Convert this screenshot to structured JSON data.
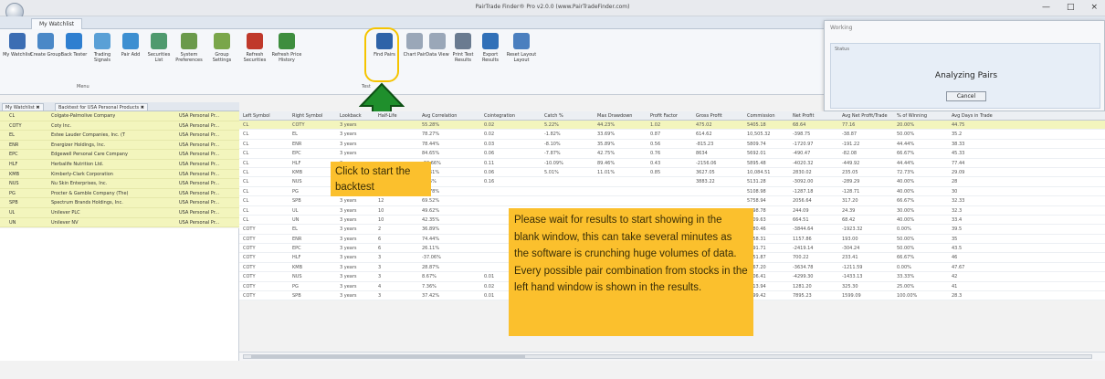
{
  "window": {
    "title": "PairTrade Finder® Pro v2.0.0 (www.PairTradeFinder.com)",
    "controls": [
      "—",
      "□",
      "×"
    ]
  },
  "ribbon": {
    "tab": "My Watchlist",
    "buttons": [
      {
        "label": "My Watchlist",
        "icon": "watchlist-icon",
        "color": "#3b6db3"
      },
      {
        "label": "Create Group",
        "icon": "create-group-icon",
        "color": "#4a88c7"
      },
      {
        "label": "Back Tester",
        "icon": "back-tester-icon",
        "color": "#2f7fd0"
      },
      {
        "label": "Trading Signals",
        "icon": "trading-signals-icon",
        "color": "#5aa0d6"
      },
      {
        "label": "Pair Add",
        "icon": "pair-add-icon",
        "color": "#3d8fd1"
      },
      {
        "label": "Securities List",
        "icon": "securities-list-icon",
        "color": "#4f9a6e"
      },
      {
        "label": "System Preferences",
        "icon": "system-preferences-icon",
        "color": "#6b9a4b"
      },
      {
        "label": "Group Settings",
        "icon": "group-settings-icon",
        "color": "#7aa64a"
      },
      {
        "label": "Refresh Securities",
        "icon": "refresh-securities-icon",
        "color": "#c0392b"
      },
      {
        "label": "Refresh Price History",
        "icon": "refresh-price-history-icon",
        "color": "#3e8e3e"
      },
      {
        "label": "Find Pairs",
        "icon": "find-pairs-icon",
        "color": "#2e63a8"
      },
      {
        "label": "Chart Pair",
        "icon": "chart-pair-icon",
        "color": "#9aa7b8"
      },
      {
        "label": "Data View",
        "icon": "data-view-icon",
        "color": "#9aa7b8"
      },
      {
        "label": "Print Test Results",
        "icon": "print-test-results-icon",
        "color": "#6a7b90"
      },
      {
        "label": "Export Results",
        "icon": "export-results-icon",
        "color": "#3070b8"
      },
      {
        "label": "Reset Layout Layout",
        "icon": "reset-layout-icon",
        "color": "#4a7fbf"
      }
    ],
    "group_menu": "Menu",
    "group_test": "Test"
  },
  "dialog": {
    "title": "Working",
    "status_label": "Status",
    "status_text": "Analyzing Pairs",
    "cancel": "Cancel"
  },
  "left_panel": {
    "tabs": [
      "My Watchlist",
      "Backtest for USA Personal Products"
    ],
    "rows": [
      {
        "symbol": "CL",
        "name": "Colgate-Palmolive Company",
        "group": "USA Personal Pr..."
      },
      {
        "symbol": "COTY",
        "name": "Coty Inc.",
        "group": "USA Personal Pr..."
      },
      {
        "symbol": "EL",
        "name": "Estee Lauder Companies, Inc. (T",
        "group": "USA Personal Pr..."
      },
      {
        "symbol": "ENR",
        "name": "Energizer Holdings, Inc.",
        "group": "USA Personal Pr..."
      },
      {
        "symbol": "EPC",
        "name": "Edgewell Personal Care Company",
        "group": "USA Personal Pr..."
      },
      {
        "symbol": "HLF",
        "name": "Herbalife Nutrition Ltd.",
        "group": "USA Personal Pr..."
      },
      {
        "symbol": "KMB",
        "name": "Kimberly-Clark Corporation",
        "group": "USA Personal Pr..."
      },
      {
        "symbol": "NUS",
        "name": "Nu Skin Enterprises, Inc.",
        "group": "USA Personal Pr..."
      },
      {
        "symbol": "PG",
        "name": "Procter & Gamble Company (The)",
        "group": "USA Personal Pr..."
      },
      {
        "symbol": "SPB",
        "name": "Spectrum Brands Holdings, Inc.",
        "group": "USA Personal Pr..."
      },
      {
        "symbol": "UL",
        "name": "Unilever PLC",
        "group": "USA Personal Pr..."
      },
      {
        "symbol": "UN",
        "name": "Unilever NV",
        "group": "USA Personal Pr..."
      }
    ]
  },
  "grid": {
    "headers": [
      "Left Symbol",
      "Right Symbol",
      "Lookback",
      "Half-Life",
      "Avg Correlation",
      "Cointegration",
      "Catch %",
      "Max Drawdown",
      "Profit Factor",
      "Gross Profit",
      "Commission",
      "Net Profit",
      "Avg Net Profit/Trade",
      "% of Winning",
      "Avg Days in Trade"
    ],
    "rows": [
      [
        "CL",
        "COTY",
        "3 years",
        "",
        "55.28%",
        "0.02",
        "5.22%",
        "44.23%",
        "1.02",
        "475.02",
        "5405.18",
        "68.64",
        "77.16",
        "20.00%",
        "44.75"
      ],
      [
        "CL",
        "EL",
        "3 years",
        "",
        "78.27%",
        "0.02",
        "-1.82%",
        "33.69%",
        "0.87",
        "614.62",
        "10,505.32",
        "-398.75",
        "-38.87",
        "50.00%",
        "35.2"
      ],
      [
        "CL",
        "ENR",
        "3 years",
        "",
        "78.44%",
        "0.03",
        "-8.10%",
        "35.89%",
        "0.56",
        "-815.23",
        "5809.74",
        "-1720.97",
        "-191.22",
        "44.44%",
        "38.33"
      ],
      [
        "CL",
        "EPC",
        "3 years",
        "",
        "84.65%",
        "0.06",
        "-7.87%",
        "42.75%",
        "0.76",
        "8634",
        "5692.01",
        "-490.47",
        "-82.08",
        "66.67%",
        "45.33"
      ],
      [
        "CL",
        "HLF",
        "3 years",
        "",
        "-20.66%",
        "0.11",
        "-10.09%",
        "89.46%",
        "0.43",
        "-2156.06",
        "5895.48",
        "-4020.32",
        "-449.92",
        "44.44%",
        "77.44"
      ],
      [
        "CL",
        "KMB",
        "3 years",
        "",
        "87.61%",
        "0.06",
        "5.01%",
        "11.01%",
        "0.85",
        "3627.05",
        "10,084.51",
        "2830.02",
        "235.05",
        "72.73%",
        "29.09"
      ],
      [
        "CL",
        "NUS",
        "3 years",
        "10",
        "5.55%",
        "0.16",
        "",
        "",
        "",
        "3883.22",
        "5131.28",
        "-3092.00",
        "-289.29",
        "40.00%",
        "28"
      ],
      [
        "CL",
        "PG",
        "3 years",
        "10",
        "56.78%",
        "",
        "",
        "",
        "",
        "",
        "5108.98",
        "-1287.18",
        "-128.71",
        "40.00%",
        "30"
      ],
      [
        "CL",
        "SPB",
        "3 years",
        "12",
        "69.52%",
        "",
        "",
        "",
        "",
        "",
        "5758.94",
        "2056.64",
        "317.20",
        "66.67%",
        "32.33"
      ],
      [
        "CL",
        "UL",
        "3 years",
        "10",
        "49.62%",
        "",
        "",
        "",
        "",
        "",
        "2998.78",
        "244.09",
        "24.39",
        "30.00%",
        "32.3"
      ],
      [
        "CL",
        "UN",
        "3 years",
        "10",
        "42.35%",
        "",
        "",
        "",
        "",
        "",
        "5109.63",
        "664.51",
        "68.42",
        "40.00%",
        "33.4"
      ],
      [
        "COTY",
        "EL",
        "3 years",
        "2",
        "36.89%",
        "",
        "",
        "",
        "",
        "",
        "5780.46",
        "-3844.64",
        "-1923.32",
        "0.00%",
        "39.5"
      ],
      [
        "COTY",
        "ENR",
        "3 years",
        "6",
        "74.44%",
        "",
        "",
        "",
        "",
        "",
        "3958.31",
        "1157.86",
        "193.00",
        "50.00%",
        "35"
      ],
      [
        "COTY",
        "EPC",
        "3 years",
        "6",
        "26.11%",
        "",
        "",
        "",
        "",
        "",
        "5391.71",
        "-2419.14",
        "-304.24",
        "50.00%",
        "43.5"
      ],
      [
        "COTY",
        "HLF",
        "3 years",
        "3",
        "-37.06%",
        "",
        "",
        "",
        "",
        "",
        "3351.87",
        "700.22",
        "233.41",
        "66.67%",
        "46"
      ],
      [
        "COTY",
        "KMB",
        "3 years",
        "3",
        "28.87%",
        "",
        "",
        "",
        "",
        "",
        "5267.20",
        "-3634.78",
        "-1211.59",
        "0.00%",
        "47.67"
      ],
      [
        "COTY",
        "NUS",
        "3 years",
        "3",
        "8.67%",
        "0.01",
        "-11.08%",
        "49.44%",
        "0.66",
        "-4612.89",
        "5306.41",
        "-4299.30",
        "-1433.13",
        "33.33%",
        "42"
      ],
      [
        "COTY",
        "PG",
        "3 years",
        "4",
        "7.36%",
        "0.02",
        "-6.19%",
        "34.60%",
        "1.24",
        "1899.85",
        "3413.94",
        "1281.20",
        "325.30",
        "25.00%",
        "41"
      ],
      [
        "COTY",
        "SPB",
        "3 years",
        "3",
        "37.42%",
        "0.01",
        "21.65%",
        "13.07%",
        "0.65",
        "8484.65",
        "5499.42",
        "7895.23",
        "1599.09",
        "100.00%",
        "28.3"
      ]
    ]
  },
  "callouts": {
    "backtest": "Click to start the backtest",
    "wait": "Please wait for results to start showing in the blank window, this can take several minutes as the software is crunching huge volumes of data. Every possible pair combination from stocks in the left hand window is shown in the results."
  },
  "colors": {
    "highlight": "#f5c400",
    "arrow": "#1f8f2c",
    "callout": "#fbc02d",
    "selected_row": "#f3f5bd"
  }
}
